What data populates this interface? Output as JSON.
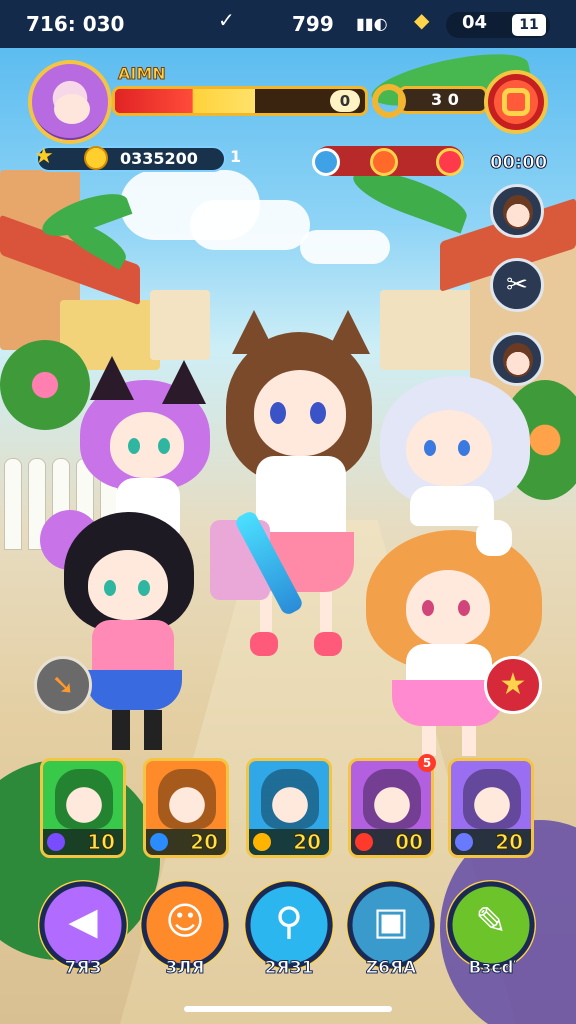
{
  "status_bar": {
    "time": "716: 030",
    "center_value": "799",
    "right_value": "04",
    "box_value": "11"
  },
  "player": {
    "name": "AIMN",
    "hp_fraction": 0.56,
    "hp_end_value": "0",
    "energy_value": "3 0",
    "coins": "03352001",
    "coins_suffix": "",
    "timer": "00:00"
  },
  "coins_display": "0335200",
  "coins_trailing": "1",
  "cards": [
    {
      "level": "10",
      "elem_color": "#7a4cff",
      "bg": "#38c94a"
    },
    {
      "level": "20",
      "elem_color": "#2a8cff",
      "bg": "#ff8a2a"
    },
    {
      "level": "20",
      "elem_color": "#ffb400",
      "bg": "#30a8e8"
    },
    {
      "level": "00",
      "elem_color": "#ff3a2a",
      "bg": "#b25fe0"
    },
    {
      "level": "20",
      "elem_color": "#6a7aff",
      "bg": "#9a6ef0"
    }
  ],
  "card_badge": "5",
  "nav": [
    {
      "label": "7ЯЗ",
      "color": "#b26bff"
    },
    {
      "label": "3ЛЯ",
      "color": "#ff8a2a"
    },
    {
      "label": "2ЯЗ1",
      "color": "#2bb6f0"
    },
    {
      "label": "Z6ЯA",
      "color": "#3a9acb"
    },
    {
      "label": "Bзєď",
      "color": "#6cc32a"
    }
  ],
  "colors": {
    "accent_gold": "#f4c542",
    "hp_red": "#e02424",
    "status_bg": "#132a4a"
  }
}
